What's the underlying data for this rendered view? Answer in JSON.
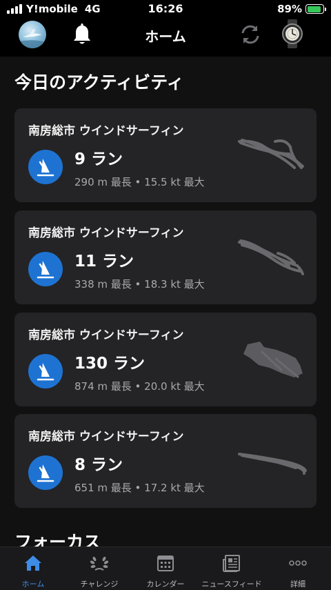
{
  "status_bar": {
    "carrier": "Y!mobile",
    "network": "4G",
    "time": "16:26",
    "battery_percent": "89%",
    "battery_level": 0.89,
    "battery_color": "#35c759"
  },
  "nav": {
    "title": "ホーム",
    "icons": [
      "profile-avatar",
      "bell-icon",
      "sync-icon",
      "watch-icon"
    ]
  },
  "activities": {
    "section_title": "今日のアクティビティ",
    "items": [
      {
        "title": "南房総市 ウインドサーフィン",
        "runs": "9 ラン",
        "stats": "290 m 最長 • 15.5 kt 最大",
        "icon": "windsurf-icon"
      },
      {
        "title": "南房総市 ウインドサーフィン",
        "runs": "11 ラン",
        "stats": "338 m 最長 • 18.3 kt 最大",
        "icon": "windsurf-icon"
      },
      {
        "title": "南房総市 ウインドサーフィン",
        "runs": "130 ラン",
        "stats": "874 m 最長 • 20.0 kt 最大",
        "icon": "windsurf-icon"
      },
      {
        "title": "南房総市 ウインドサーフィン",
        "runs": "8 ラン",
        "stats": "651 m 最長 • 17.2 kt 最大",
        "icon": "windsurf-icon"
      }
    ]
  },
  "focus": {
    "section_title": "フォーカス"
  },
  "tabs": [
    {
      "label": "ホーム",
      "icon": "home-icon",
      "active": true
    },
    {
      "label": "チャレンジ",
      "icon": "laurel-icon",
      "active": false
    },
    {
      "label": "カレンダー",
      "icon": "calendar-icon",
      "active": false
    },
    {
      "label": "ニュースフィード",
      "icon": "newsfeed-icon",
      "active": false
    },
    {
      "label": "詳細",
      "icon": "more-icon",
      "active": false
    }
  ],
  "colors": {
    "accent": "#1e73d2",
    "tab_active": "#3d8ce6",
    "card_bg": "#242426",
    "background": "#111112"
  }
}
